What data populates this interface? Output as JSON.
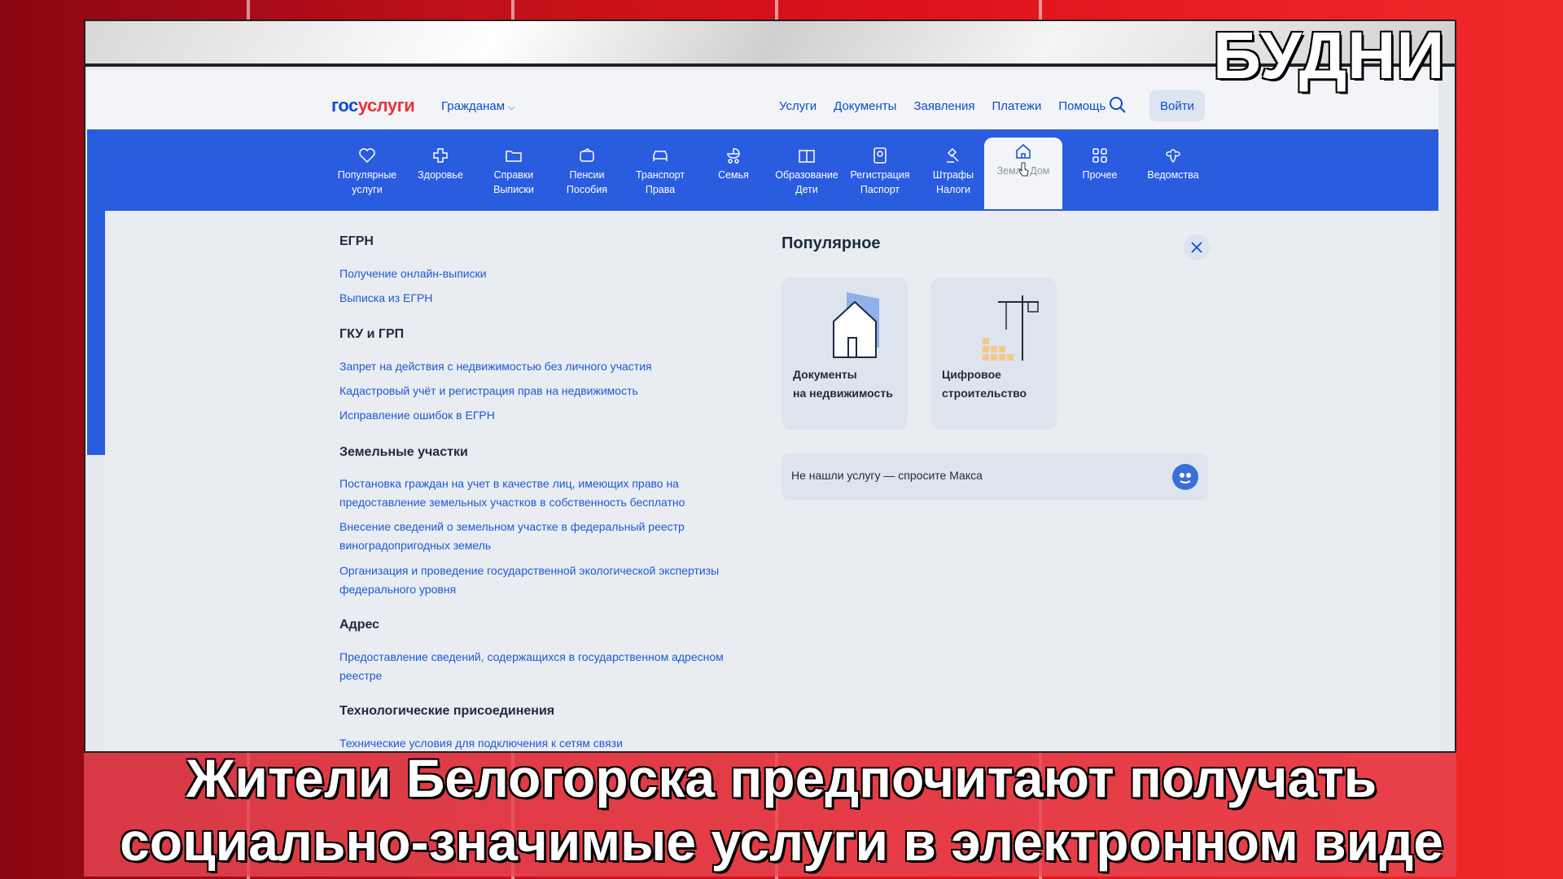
{
  "header": {
    "logo_a": "гос",
    "logo_b": "услуги",
    "audience": "Гражданам",
    "nav": [
      "Услуги",
      "Документы",
      "Заявления",
      "Платежи",
      "Помощь"
    ],
    "login": "Войти"
  },
  "categories": [
    {
      "line1": "Популярные",
      "line2": "услуги",
      "icon": "heart-icon"
    },
    {
      "line1": "Здоровье",
      "line2": "",
      "icon": "health-cross-icon"
    },
    {
      "line1": "Справки",
      "line2": "Выписки",
      "icon": "folder-icon"
    },
    {
      "line1": "Пенсии",
      "line2": "Пособия",
      "icon": "wallet-icon"
    },
    {
      "line1": "Транспорт",
      "line2": "Права",
      "icon": "car-icon"
    },
    {
      "line1": "Семья",
      "line2": "",
      "icon": "stroller-icon"
    },
    {
      "line1": "Образование",
      "line2": "Дети",
      "icon": "book-icon"
    },
    {
      "line1": "Регистрация",
      "line2": "Паспорт",
      "icon": "passport-icon"
    },
    {
      "line1": "Штрафы",
      "line2": "Налоги",
      "icon": "gavel-icon"
    },
    {
      "line1": "Земля Дом",
      "line2": "",
      "icon": "home-icon"
    },
    {
      "line1": "Прочее",
      "line2": "",
      "icon": "grid-icon"
    },
    {
      "line1": "Ведомства",
      "line2": "",
      "icon": "emblem-icon"
    }
  ],
  "sections": [
    {
      "title": "ЕГРН",
      "links": [
        "Получение онлайн-выписки",
        "Выписка из ЕГРН"
      ]
    },
    {
      "title": "ГКУ и ГРП",
      "links": [
        "Запрет на действия с недвижимостью без личного участия",
        "Кадастровый учёт и регистрация прав на недвижимость",
        "Исправление ошибок в ЕГРН"
      ]
    },
    {
      "title": "Земельные участки",
      "links": [
        "Постановка граждан на учет в качестве лиц, имеющих право на предоставление земельных участков в собственность бесплатно",
        "Внесение сведений о земельном участке в федеральный реестр виноградопригодных земель",
        "Организация и проведение государственной экологической экспертизы федерального уровня"
      ]
    },
    {
      "title": "Адрес",
      "links": [
        "Предоставление сведений, содержащихся в государственном адресном реестре"
      ]
    },
    {
      "title": "Технологические присоединения",
      "links": [
        "Технические условия для подключения к сетям связи"
      ]
    }
  ],
  "popular": {
    "title": "Популярное",
    "cards": [
      {
        "line1": "Документы",
        "line2": "на недвижимость"
      },
      {
        "line1": "Цифровое",
        "line2": "строительство"
      }
    ],
    "ask": "Не нашли услугу — спросите Макса"
  },
  "overlay": {
    "brand": "БУДНИ",
    "caption_line1": "Жители Белогорска предпочитают получать",
    "caption_line2": "социально-значимые услуги в электронном виде"
  },
  "colors": {
    "accent": "#0d4cd3",
    "band": "#2a5ce0",
    "brand_red": "#e8343c"
  }
}
